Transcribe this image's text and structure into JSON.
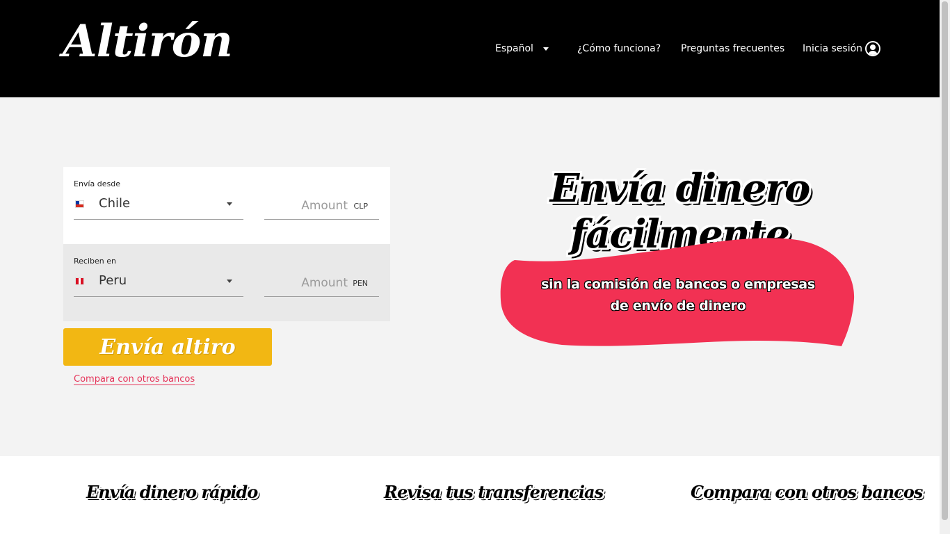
{
  "header": {
    "logo": "Altirón",
    "nav": {
      "language": "Español",
      "how_it_works": "¿Cómo funciona?",
      "faq": "Preguntas frecuentes",
      "login": "Inicia sesión"
    }
  },
  "form": {
    "send": {
      "label": "Envía desde",
      "country": "Chile",
      "flag": "chile-flag",
      "amount_placeholder": "Amount",
      "currency": "CLP"
    },
    "receive": {
      "label": "Reciben en",
      "country": "Peru",
      "flag": "peru-flag",
      "amount_placeholder": "Amount",
      "currency": "PEN"
    },
    "submit_label": "Envía altiro",
    "compare_link": "Compara con otros bancos"
  },
  "hero": {
    "title": "Envía dinero fácilmente",
    "subtitle_line1": "sin la comisión de bancos o empresas",
    "subtitle_line2": "de envío de dinero"
  },
  "features": [
    {
      "label": "Envía dinero rápido"
    },
    {
      "label": "Revisa tus transferencias"
    },
    {
      "label": "Compara con otros bancos"
    }
  ],
  "colors": {
    "header_bg": "#000000",
    "accent_yellow": "#f2b713",
    "accent_pink": "#f23153",
    "link_pink": "#e5345a"
  }
}
